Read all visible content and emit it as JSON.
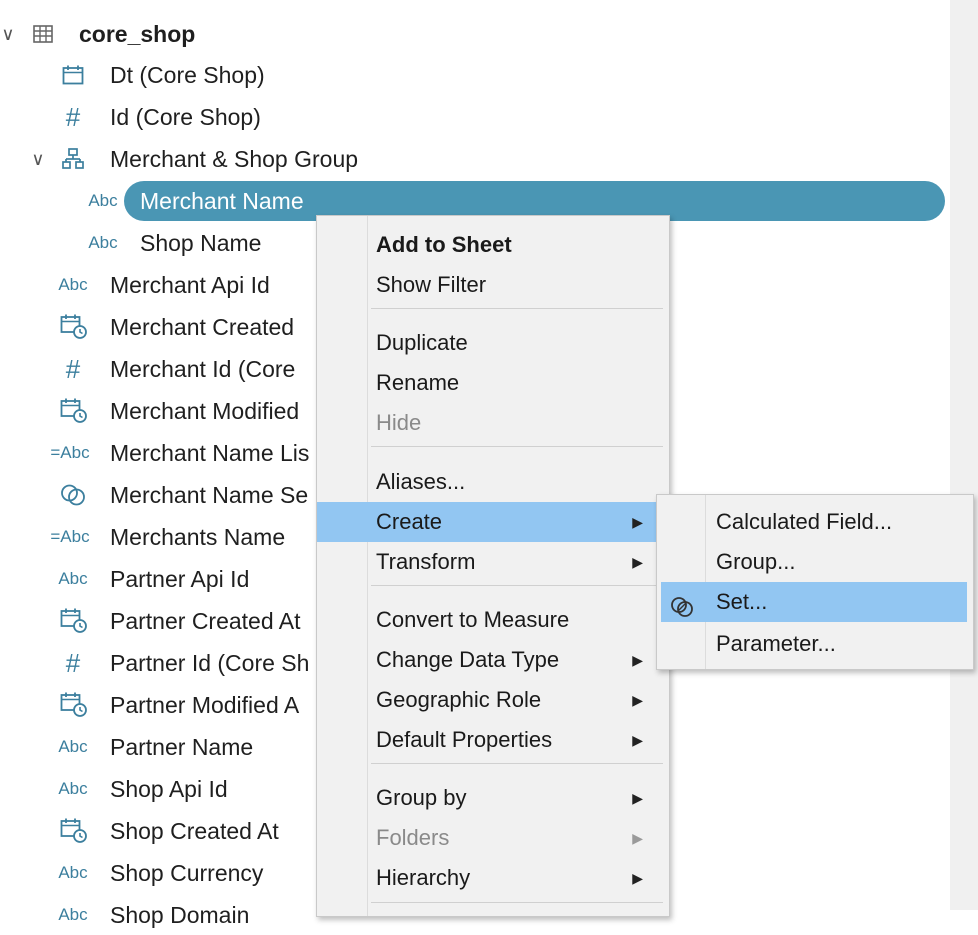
{
  "tree": {
    "root": {
      "label": "core_shop"
    },
    "items": [
      {
        "label": "Dt (Core Shop)",
        "icon": "date"
      },
      {
        "label": "Id (Core Shop)",
        "icon": "number"
      },
      {
        "label": "Merchant & Shop Group",
        "icon": "hierarchy"
      },
      {
        "label": "Merchant Name",
        "icon": "Abc"
      },
      {
        "label": "Shop Name",
        "icon": "Abc"
      },
      {
        "label": "Merchant Api Id",
        "icon": "Abc"
      },
      {
        "label": "Merchant Created",
        "icon": "datetime"
      },
      {
        "label": "Merchant Id (Core",
        "icon": "number"
      },
      {
        "label": "Merchant Modified",
        "icon": "datetime"
      },
      {
        "label": "Merchant Name Lis",
        "icon": "=Abc"
      },
      {
        "label": "Merchant Name Se",
        "icon": "set"
      },
      {
        "label": "Merchants Name",
        "icon": "=Abc"
      },
      {
        "label": "Partner Api Id",
        "icon": "Abc"
      },
      {
        "label": "Partner Created At",
        "icon": "datetime"
      },
      {
        "label": "Partner Id (Core Sh",
        "icon": "number"
      },
      {
        "label": "Partner Modified A",
        "icon": "datetime"
      },
      {
        "label": "Partner Name",
        "icon": "Abc"
      },
      {
        "label": "Shop Api Id",
        "icon": "Abc"
      },
      {
        "label": "Shop Created At",
        "icon": "datetime"
      },
      {
        "label": "Shop Currency",
        "icon": "Abc"
      },
      {
        "label": "Shop Domain",
        "icon": "Abc"
      }
    ],
    "icon_text": {
      "abc": "Abc",
      "calc_abc": "=Abc",
      "hash": "#"
    }
  },
  "context_menu": {
    "items": [
      "Add to Sheet",
      "Show Filter",
      "Duplicate",
      "Rename",
      "Hide",
      "Aliases...",
      "Create",
      "Transform",
      "Convert to Measure",
      "Change Data Type",
      "Geographic Role",
      "Default Properties",
      "Group by",
      "Folders",
      "Hierarchy"
    ],
    "highlighted": "Create"
  },
  "submenu": {
    "items": [
      "Calculated Field...",
      "Group...",
      "Set...",
      "Parameter..."
    ],
    "highlighted": "Set..."
  },
  "colors": {
    "accent": "#4a96b4",
    "icon": "#3c7f9e",
    "menu_highlight": "#92c6f2",
    "menu_bg": "#f1f1f1"
  }
}
